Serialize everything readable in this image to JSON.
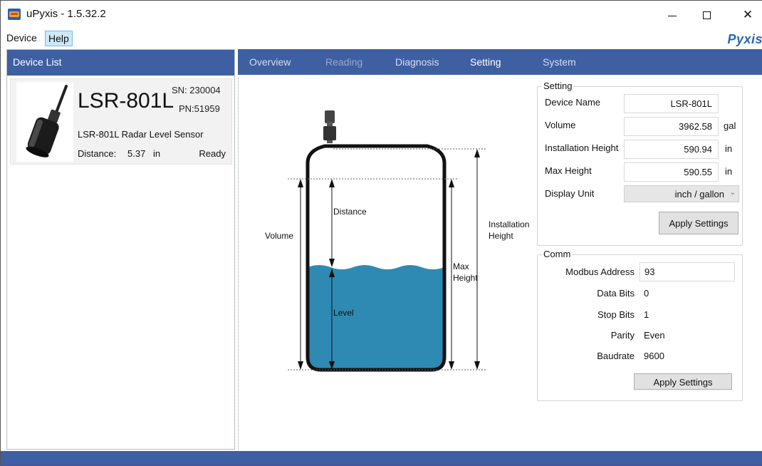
{
  "window": {
    "title": "uPyxis - 1.5.32.2",
    "brand": "Pyxis"
  },
  "menu": {
    "device": "Device",
    "help": "Help"
  },
  "device_list": {
    "header": "Device List",
    "card": {
      "name": "LSR-801L",
      "sn": "SN: 230004",
      "pn": "PN:51959",
      "description": "LSR-801L Radar Level Sensor",
      "distance_label": "Distance:",
      "distance_value": "5.37",
      "distance_unit": "in",
      "status": "Ready"
    }
  },
  "tabs": [
    "Overview",
    "Reading",
    "Diagnosis",
    "Setting",
    "System"
  ],
  "diagram": {
    "volume": "Volume",
    "distance": "Distance",
    "level": "Level",
    "installation_height_1": "Installation",
    "installation_height_2": "Height",
    "max_height_1": "Max",
    "max_height_2": "Height",
    "colors": {
      "liquid": "#2e8ab2",
      "tank_stroke": "#111111"
    }
  },
  "setting": {
    "title": "Setting",
    "device_name_label": "Device Name",
    "device_name_value": "LSR-801L",
    "volume_label": "Volume",
    "volume_value": "3962.58",
    "volume_unit": "gal",
    "installation_height_label": "Installation Height",
    "installation_height_value": "590.94",
    "installation_height_unit": "in",
    "max_height_label": "Max Height",
    "max_height_value": "590.55",
    "max_height_unit": "in",
    "display_unit_label": "Display Unit",
    "display_unit_value": "inch / gallon",
    "apply_label": "Apply Settings"
  },
  "comm": {
    "title": "Comm",
    "modbus_address_label": "Modbus Address",
    "modbus_address_value": "93",
    "data_bits_label": "Data Bits",
    "data_bits_value": "0",
    "stop_bits_label": "Stop Bits",
    "stop_bits_value": "1",
    "parity_label": "Parity",
    "parity_value": "Even",
    "baudrate_label": "Baudrate",
    "baudrate_value": "9600",
    "apply_label": "Apply Settings"
  },
  "theme": {
    "accent": "#3f5fa3",
    "brand_color": "#2a66b0"
  }
}
